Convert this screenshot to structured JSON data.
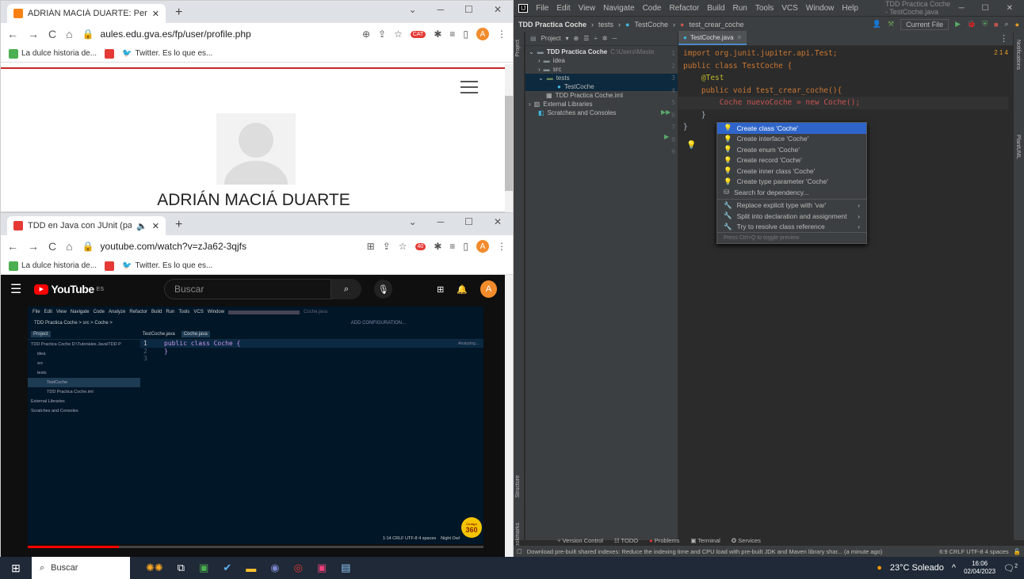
{
  "browser1": {
    "tab_title": "ADRIÁN MACIÁ DUARTE: Perfil p",
    "url": "aules.edu.gva.es/fp/user/profile.php",
    "bookmarks": [
      "La dulce historia de...",
      "Twitter. Es lo que es..."
    ],
    "profile_name": "ADRIÁN MACIÁ DUARTE",
    "ext_badge": "CAT"
  },
  "browser2": {
    "tab_title": "TDD en Java con JUnit (parte",
    "url": "youtube.com/watch?v=zJa62-3qjfs",
    "bookmarks": [
      "La dulce historia de...",
      "Twitter. Es lo que es..."
    ],
    "ext_badge": "40"
  },
  "youtube": {
    "logo": "YouTube",
    "region": "ES",
    "search_placeholder": "Buscar",
    "avatar": "A"
  },
  "video": {
    "menu": [
      "File",
      "Edit",
      "View",
      "Navigate",
      "Code",
      "Analyze",
      "Refactor",
      "Build",
      "Run",
      "Tools",
      "VCS",
      "Window"
    ],
    "tab_label": "Coche.java",
    "breadcrumb": "TDD Practica Coche > src > Coche >",
    "config_btn": "ADD CONFIGURATION...",
    "project_label": "Project",
    "tabs": [
      "TestCoche.java",
      "Coche.java"
    ],
    "tree": [
      "TDD Practica Coche D:\\Tutoriales Java\\TDD P",
      "idea",
      "src",
      "tests",
      "TestCoche",
      "TDD Practica Coche.iml",
      "External Libraries",
      "Scratches and Consoles"
    ],
    "code_line": "public class Coche {",
    "line_nums": [
      "1",
      "2",
      "3"
    ],
    "close_brace": "}",
    "analyzing": "Analyzing...",
    "status": "1:14  CRLF  UTF-8  4 spaces",
    "theme": "Night Owl",
    "badge_top": "Código",
    "badge_num": "360"
  },
  "ide": {
    "menu": [
      "File",
      "Edit",
      "View",
      "Navigate",
      "Code",
      "Refactor",
      "Build",
      "Run",
      "Tools",
      "VCS",
      "Window",
      "Help"
    ],
    "title": "TDD Practica Coche - TestCoche.java",
    "breadcrumbs": [
      "TDD Practica Coche",
      "tests",
      "TestCoche",
      "test_crear_coche"
    ],
    "run_config": "Current File",
    "project_label": "Project",
    "editor_tab": "TestCoche.java",
    "tree": [
      "TDD Practica Coche",
      "C:\\Users\\Maste",
      "idea",
      "src",
      "tests",
      "TestCoche",
      "TDD Practica Coche.iml",
      "External Libraries",
      "Scratches and Consoles"
    ],
    "code": [
      "import org.junit.jupiter.api.Test;",
      "",
      "public class TestCoche {",
      "    @Test",
      "    public void test_crear_coche(){",
      "        Coche nuevoCoche = new Coche();",
      "    }",
      "}"
    ],
    "line_nums": [
      "1",
      "2",
      "3",
      "4",
      "5",
      "6",
      "7",
      "8",
      "9"
    ],
    "inspection": "2  1  4",
    "popup": [
      "Create class 'Coche'",
      "Create interface 'Coche'",
      "Create enum 'Coche'",
      "Create record 'Coche'",
      "Create inner class 'Coche'",
      "Create type parameter 'Coche'",
      "Search for dependency...",
      "Replace explicit type with 'var'",
      "Split into declaration and assignment",
      "Try to resolve class reference"
    ],
    "popup_footer": "Press Ctrl+Q to toggle preview",
    "side_left": [
      "Project",
      "Structure",
      "Bookmarks"
    ],
    "side_right": [
      "Notifications",
      "PlantUML"
    ],
    "bottom_tabs": [
      "Version Control",
      "TODO",
      "Problems",
      "Terminal",
      "Services"
    ],
    "status_msg": "Download pre-built shared indexes: Reduce the indexing time and CPU load with pre-built JDK and Maven library shar... (a minute ago)",
    "status_right": "6:9  CRLF  UTF-8  4 spaces"
  },
  "taskbar": {
    "search": "Buscar",
    "weather": "23°C Soleado",
    "time": "16:06",
    "date": "02/04/2023",
    "notif": "2"
  }
}
